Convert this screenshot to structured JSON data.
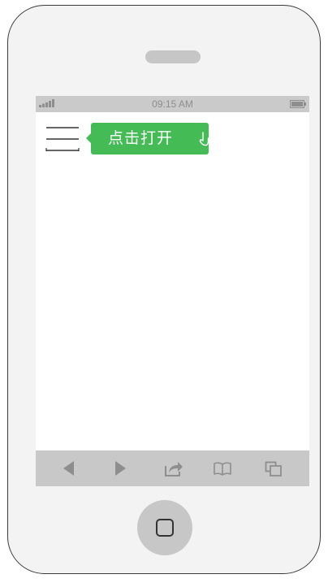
{
  "status_bar": {
    "time": "09:15 AM",
    "signal_icon": "signal-bars-icon",
    "battery_icon": "battery-icon"
  },
  "app": {
    "menu_icon": "hamburger-menu-icon",
    "tooltip": {
      "label": "点击打开",
      "icon": "tap-hand-icon",
      "color": "#44bb55"
    }
  },
  "browser_toolbar": {
    "buttons": [
      {
        "name": "back",
        "icon": "back-arrow-icon"
      },
      {
        "name": "forward",
        "icon": "forward-arrow-icon"
      },
      {
        "name": "share",
        "icon": "share-icon"
      },
      {
        "name": "bookmarks",
        "icon": "book-icon"
      },
      {
        "name": "tabs",
        "icon": "tabs-icon"
      }
    ]
  },
  "device": {
    "frame_color": "#f3f3f3",
    "toolbar_color": "#c8c8c8",
    "icon_color": "#8e8e8e"
  }
}
